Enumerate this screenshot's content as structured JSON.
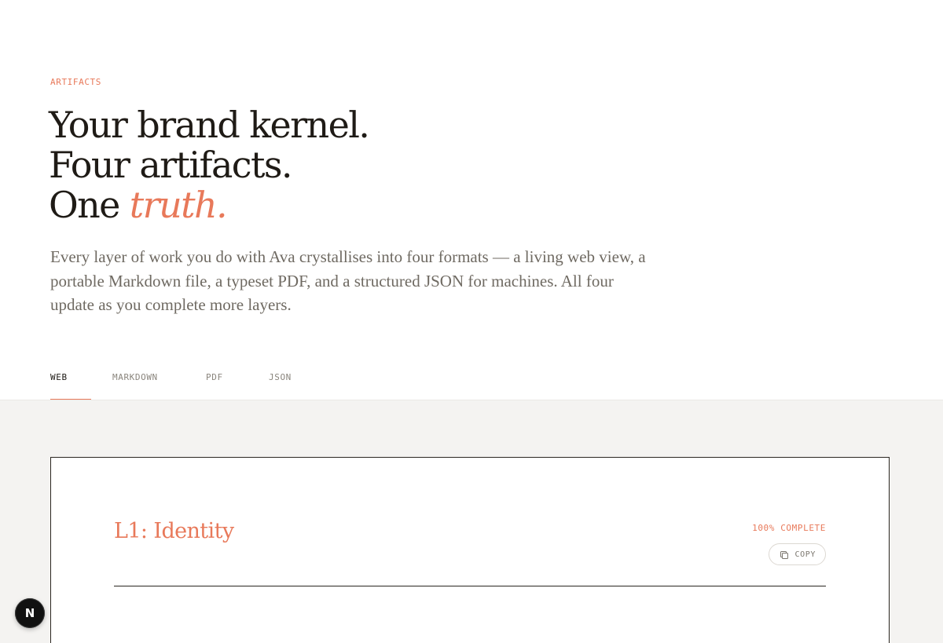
{
  "hero": {
    "eyebrow": "ARTIFACTS",
    "headline_line1": "Your brand kernel.",
    "headline_line2": "Four artifacts.",
    "headline_line3_lead": "One ",
    "headline_line3_accent": "truth.",
    "lede": "Every layer of work you do with Ava crystallises into four formats — a living web view, a portable Markdown file, a typeset PDF, and a structured JSON for machines. All four update as you complete more layers."
  },
  "tabs": [
    {
      "label": "WEB",
      "active": true
    },
    {
      "label": "MARKDOWN",
      "active": false
    },
    {
      "label": "PDF",
      "active": false
    },
    {
      "label": "JSON",
      "active": false
    }
  ],
  "card": {
    "title": "L1: Identity",
    "complete_label": "100% COMPLETE",
    "copy_label": "COPY",
    "copy_icon": "copy-icon"
  },
  "badge": {
    "label": "N",
    "icon": "nextjs-icon"
  },
  "colors": {
    "accent": "#e8795a",
    "ink": "#1f1b16",
    "muted": "#6f6a62",
    "surface": "#f4f3f1"
  }
}
